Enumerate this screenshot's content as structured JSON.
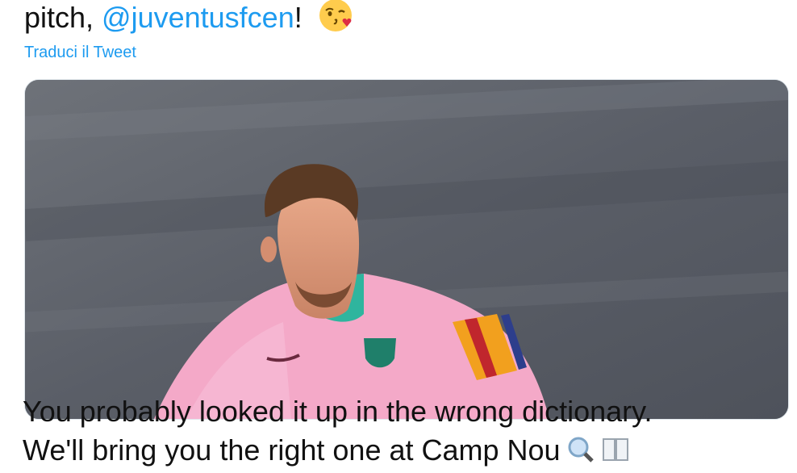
{
  "tweet1": {
    "text_before": "pitch, ",
    "mention": "@juventusfcen",
    "text_after": "!",
    "emoji_icon": "face-blowing-kiss-icon",
    "translate_label": "Traduci il Tweet"
  },
  "media": {
    "jersey_color": "#f4a9c8",
    "background_color": "#5c6069"
  },
  "tweet2": {
    "line1": "You probably looked it up in the wrong dictionary.",
    "line2": "We'll bring you the right one at Camp Nou",
    "icons": [
      "magnifying-glass-icon",
      "book-icon"
    ]
  },
  "colors": {
    "link": "#1d9bf0",
    "text": "#111111"
  }
}
